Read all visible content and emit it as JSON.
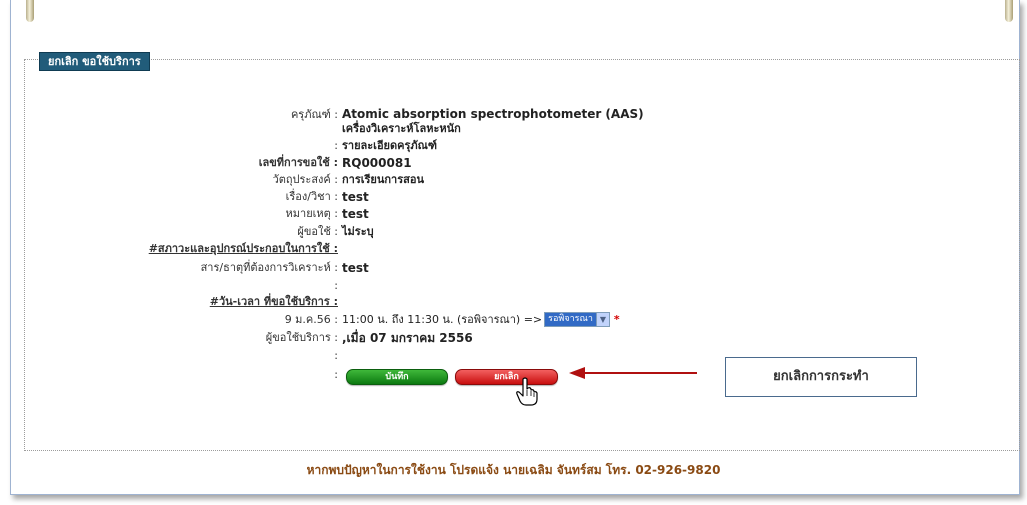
{
  "panel": {
    "legend": "ยกเลิก ขอใช้บริการ"
  },
  "details": {
    "equipment_label": "ครุภัณฑ์ :",
    "equipment_name_en": "Atomic absorption spectrophotometer (AAS)",
    "equipment_name_th": "เครื่องวิเคราะห์โลหะหนัก",
    "equipment_detail_label": ":",
    "equipment_detail_value": "รายละเอียดครุภัณฑ์",
    "request_no_label": "เลขที่การขอใช้ :",
    "request_no_value": "RQ000081",
    "purpose_label": "วัตถุประสงค์ :",
    "purpose_value": "การเรียนการสอน",
    "subject_label": "เรื่อง/วิชา :",
    "subject_value": "test",
    "note_label": "หมายเหตุ :",
    "note_value": "test",
    "requester_label": "ผู้ขอใช้ :",
    "requester_value": "ไม่ระบุ",
    "conditions_label": "#สภาวะและอุปกรณ์ประกอบในการใช้ :",
    "substance_label": "สาร/ธาตุที่ต้องการวิเคราะห์ :",
    "substance_value": "test",
    "blank1_label": ":",
    "datetime_label": "#วัน-เวลา ที่ขอใช้บริการ :",
    "date_label": "9 ม.ค.56 :",
    "time_value": "11:00 น. ถึง 11:30 น. (รอพิจารณา) =>",
    "status_selected": "รอพิจารณา",
    "required_mark": "*",
    "service_requester_label": "ผู้ขอใช้บริการ :",
    "service_requester_value": ",เมื่อ 07 มกราคม 2556",
    "blank2_label": ":",
    "buttons_label": ":"
  },
  "buttons": {
    "save_label": "บันทึก",
    "cancel_label": "ยกเลิก"
  },
  "callout": {
    "text": "ยกเลิกการกระทำ"
  },
  "footer": {
    "text": "หากพบปัญหาในการใช้งาน โปรดแจ้ง นายเฉลิม จันทร์สม โทร. 02-926-9820"
  },
  "colors": {
    "legend_bg": "#215c7a",
    "save_green": "#0c7a10",
    "cancel_red": "#c80e0e",
    "arrow_red": "#b01010",
    "footer_brown": "#8a4a13"
  },
  "icons": {
    "arrow": "arrow-left-icon",
    "cursor": "hand-pointer-icon",
    "dropdown": "chevron-down-icon"
  }
}
